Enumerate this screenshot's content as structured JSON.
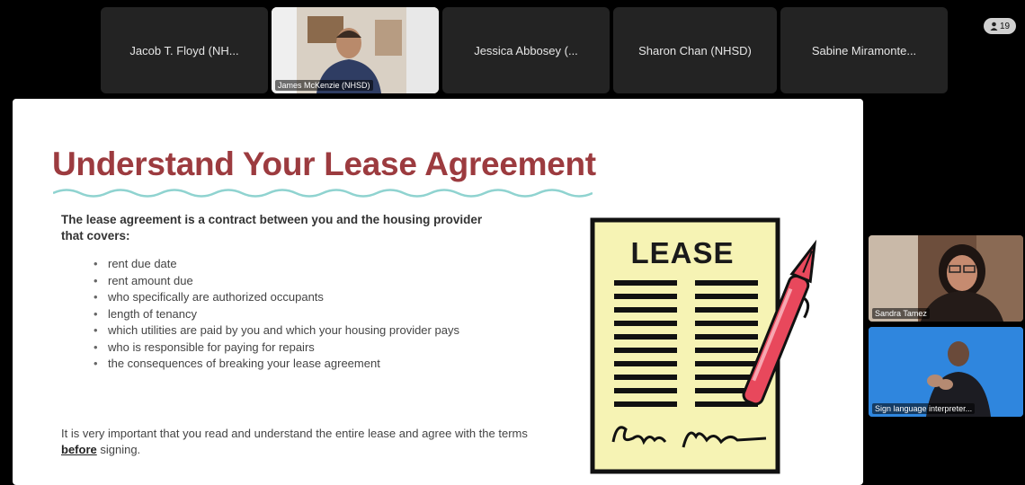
{
  "participants": {
    "tile1": "Jacob T. Floyd (NH...",
    "tile2_video_label": "James McKenzie (NHSD)",
    "tile3": "Jessica Abbosey (...",
    "tile4": "Sharon Chan (NHSD)",
    "tile5": "Sabine Miramonte..."
  },
  "participant_count": "19",
  "side_videos": [
    {
      "label": "Sandra Tamez"
    },
    {
      "label": "Sign language interpreter..."
    }
  ],
  "slide": {
    "title": "Understand Your Lease Agreement",
    "intro": "The lease agreement is a contract between you and the housing provider that covers:",
    "bullets": [
      "rent due date",
      "rent amount due",
      "who specifically are authorized occupants",
      "length of tenancy",
      "which utilities are paid by you and which your housing provider pays",
      "who is responsible for paying for repairs",
      "the consequences of breaking your lease agreement"
    ],
    "footer_before": "It is very important that you read and understand the entire lease and agree with the terms ",
    "footer_emphasis": "before",
    "footer_after": " signing.",
    "lease_label": "LEASE"
  },
  "colors": {
    "title": "#9c3b3f",
    "wave": "#8fd3d0",
    "lease_paper": "#f6f3b4",
    "pen": "#e8485c"
  }
}
